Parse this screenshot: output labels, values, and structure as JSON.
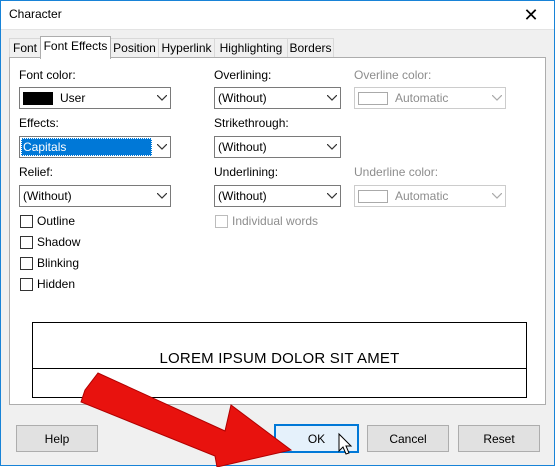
{
  "window": {
    "title": "Character",
    "close_glyph": "✕"
  },
  "tabs": [
    {
      "label": "Font",
      "active": false
    },
    {
      "label": "Font Effects",
      "active": true
    },
    {
      "label": "Position",
      "active": false
    },
    {
      "label": "Hyperlink",
      "active": false
    },
    {
      "label": "Highlighting",
      "active": false
    },
    {
      "label": "Borders",
      "active": false
    }
  ],
  "font_effects": {
    "font_color": {
      "label": "Font color:",
      "value": "User",
      "swatch_color": "#000000"
    },
    "effects": {
      "label": "Effects:",
      "value": "Capitals"
    },
    "relief": {
      "label": "Relief:",
      "value": "(Without)"
    },
    "overlining": {
      "label": "Overlining:",
      "value": "(Without)"
    },
    "strikethrough": {
      "label": "Strikethrough:",
      "value": "(Without)"
    },
    "underlining": {
      "label": "Underlining:",
      "value": "(Without)"
    },
    "overline_color": {
      "label": "Overline color:",
      "value": "Automatic"
    },
    "underline_color": {
      "label": "Underline color:",
      "value": "Automatic"
    },
    "individual_words": {
      "label": "Individual words",
      "checked": false
    },
    "checkboxes": [
      {
        "label": "Outline",
        "checked": false
      },
      {
        "label": "Shadow",
        "checked": false
      },
      {
        "label": "Blinking",
        "checked": false
      },
      {
        "label": "Hidden",
        "checked": false
      }
    ]
  },
  "preview": {
    "text": "LOREM IPSUM DOLOR SIT AMET"
  },
  "buttons": {
    "help": "Help",
    "ok": "OK",
    "cancel": "Cancel",
    "reset": "Reset"
  },
  "colors": {
    "accent": "#0078d7",
    "arrow": "#e8120e"
  }
}
